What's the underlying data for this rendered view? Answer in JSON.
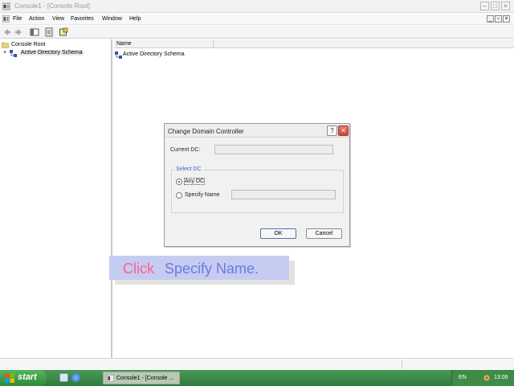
{
  "window": {
    "title": "Console1 - [Console Root]"
  },
  "menu": {
    "items": [
      "File",
      "Action",
      "View",
      "Favorites",
      "Window",
      "Help"
    ]
  },
  "tree": {
    "root": "Console Root",
    "child": "Active Directory Schema"
  },
  "list": {
    "column": "Name",
    "item": "Active Directory Schema"
  },
  "dialog": {
    "title": "Change Domain Controller",
    "help_glyph": "?",
    "close_glyph": "✕",
    "current_dc_label": "Current DC:",
    "current_dc_value": "",
    "group_label": "Select DC",
    "any_dc_label": "Any DC",
    "specify_label": "Specify Name",
    "specify_value": "",
    "ok_label": "OK",
    "cancel_label": "Cancel",
    "selected_option": "any_dc"
  },
  "caption": {
    "word1": "Click",
    "word2": "Specify Name."
  },
  "taskbar": {
    "start_label": "start",
    "task_label": "Console1 - [Console ...",
    "language": "EN",
    "clock": "13:06"
  },
  "colors": {
    "caption_bg": "#c6cbf1",
    "caption_click": "#ff5f8a",
    "caption_text": "#6a7ae3",
    "taskbar": "#3f8b48",
    "group_title": "#3b5fd6"
  },
  "icons": [
    "mmc-app-icon",
    "minimize-icon",
    "restore-icon",
    "close-icon",
    "back-arrow-icon",
    "forward-arrow-icon",
    "show-hide-tree-icon",
    "properties-icon",
    "help-icon",
    "folder-icon",
    "schema-icon",
    "windows-logo-icon",
    "ie-icon",
    "desktop-icon",
    "network-tray-icon"
  ]
}
